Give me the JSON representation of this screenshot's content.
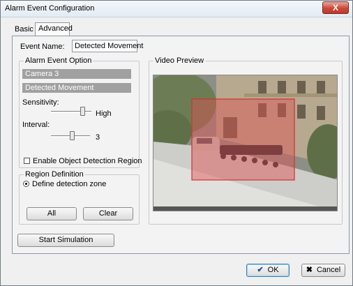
{
  "window": {
    "title": "Alarm Event Configuration",
    "close_symbol": "X"
  },
  "tabs": [
    {
      "label": "Basic"
    },
    {
      "label": "Advanced"
    }
  ],
  "event_name": {
    "label": "Event Name:",
    "value": "Detected Movement"
  },
  "alarm_event_option": {
    "title": "Alarm Event Option",
    "camera": "Camera 3",
    "event": "Detected Movement",
    "sensitivity": {
      "label": "Sensitivity:",
      "value_text": "High",
      "level": 0.75
    },
    "interval": {
      "label": "Interval:",
      "value_text": "3",
      "level": 0.5
    },
    "object_detection": {
      "label": "Enable Object Detection Region",
      "checked": false
    }
  },
  "region_definition": {
    "title": "Region Definition",
    "option": "Define detection zone",
    "all_label": "All",
    "clear_label": "Clear"
  },
  "video_preview": {
    "title": "Video Preview",
    "highlight_color": "#e05050"
  },
  "start_simulation_label": "Start Simulation",
  "footer": {
    "ok_label": "OK",
    "cancel_label": "Cancel"
  },
  "icons": {
    "ok": "check-icon",
    "cancel": "x-icon"
  }
}
